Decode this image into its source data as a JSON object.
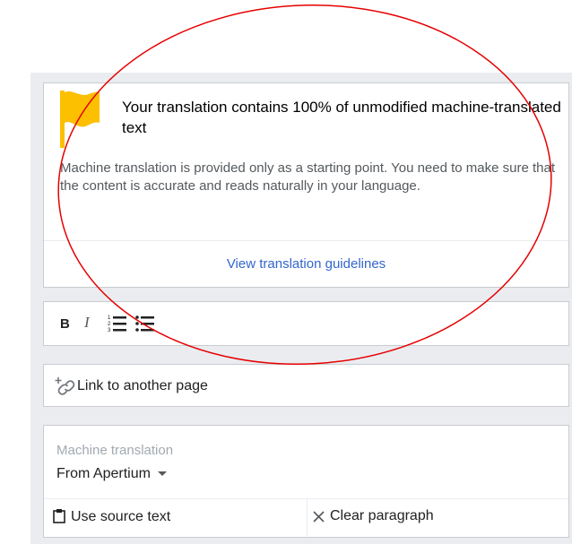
{
  "warning": {
    "title": "Your translation contains 100% of unmodified machine-translated text",
    "body": "Machine translation is provided only as a starting point. You need to make sure that the content is accurate and reads naturally in your language.",
    "link": "View translation guidelines",
    "flag_color": "#fcc000",
    "link_color": "#3366cc"
  },
  "toolbar": {
    "bold_label": "B",
    "italic_label": "I",
    "icons": [
      "bold-icon",
      "italic-icon",
      "numbered-list-icon",
      "bulleted-list-icon"
    ]
  },
  "link_tool": {
    "icon": "add-link-icon",
    "label": "Link to another page"
  },
  "machine_translation": {
    "label": "Machine translation",
    "provider": "From Apertium",
    "use_source": "Use source text",
    "clear": "Clear paragraph"
  },
  "annotation": {
    "color": "#e60000"
  }
}
